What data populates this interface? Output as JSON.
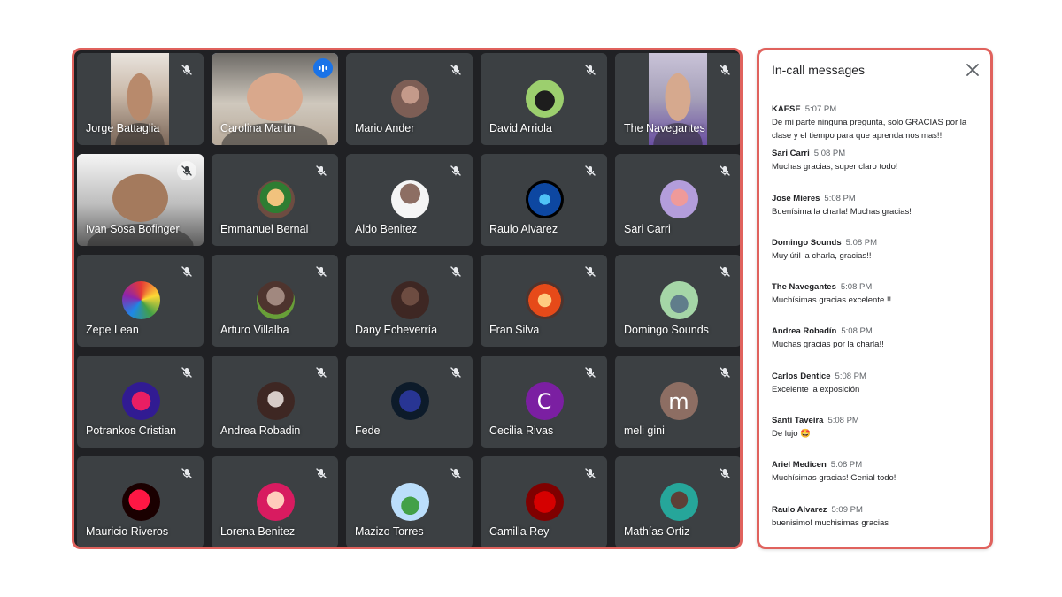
{
  "participants": [
    {
      "name": "Jorge Battaglia",
      "type": "video"
    },
    {
      "name": "Carolina Martin",
      "type": "video",
      "speaking": true
    },
    {
      "name": "Mario Ander",
      "type": "avatar"
    },
    {
      "name": "David Arriola",
      "type": "avatar"
    },
    {
      "name": "The Navegantes",
      "type": "video"
    },
    {
      "name": "Ivan Sosa Bofinger",
      "type": "video"
    },
    {
      "name": "Emmanuel Bernal",
      "type": "avatar"
    },
    {
      "name": "Aldo Benitez",
      "type": "avatar"
    },
    {
      "name": "Raulo Alvarez",
      "type": "avatar"
    },
    {
      "name": "Sari Carri",
      "type": "avatar"
    },
    {
      "name": "Zepe Lean",
      "type": "avatar"
    },
    {
      "name": "Arturo Villalba",
      "type": "avatar"
    },
    {
      "name": "Dany Echeverría",
      "type": "avatar"
    },
    {
      "name": "Fran Silva",
      "type": "avatar"
    },
    {
      "name": "Domingo Sounds",
      "type": "avatar"
    },
    {
      "name": "Potrankos Cristian",
      "type": "avatar"
    },
    {
      "name": "Andrea Robadin",
      "type": "avatar"
    },
    {
      "name": "Fede",
      "type": "avatar"
    },
    {
      "name": "Cecilia Rivas",
      "type": "letter",
      "letter": "C",
      "color": "#7b1fa2"
    },
    {
      "name": "meli gini",
      "type": "letter",
      "letter": "m",
      "color": "#8d6e63"
    },
    {
      "name": "Mauricio Riveros",
      "type": "avatar"
    },
    {
      "name": "Lorena Benitez",
      "type": "avatar"
    },
    {
      "name": "Mazizo Torres",
      "type": "avatar"
    },
    {
      "name": "Camilla Rey",
      "type": "avatar"
    },
    {
      "name": "Mathías Ortiz",
      "type": "avatar"
    }
  ],
  "chat": {
    "title": "In-call messages",
    "messages": [
      {
        "sender": "KAESE",
        "time": "5:07 PM",
        "text": "De mi parte ninguna pregunta, solo GRACIAS por la clase y el tiempo para que aprendamos mas!!"
      },
      {
        "sender": "Sari Carri",
        "time": "5:08 PM",
        "text": "Muchas gracias, super claro todo!"
      },
      {
        "sender": "Jose Mieres",
        "time": "5:08 PM",
        "text": "Buenísima la charla! Muchas gracias!"
      },
      {
        "sender": "Domingo Sounds",
        "time": "5:08 PM",
        "text": "Muy útil la charla, gracias!!"
      },
      {
        "sender": "The Navegantes",
        "time": "5:08 PM",
        "text": "Muchísimas gracias excelente !!"
      },
      {
        "sender": "Andrea Robadín",
        "time": "5:08 PM",
        "text": "Muchas gracias por la charla!!"
      },
      {
        "sender": "Carlos Dentice",
        "time": "5:08 PM",
        "text": "Excelente la exposición"
      },
      {
        "sender": "Santi Taveira",
        "time": "5:08 PM",
        "text": "De lujo 🤩"
      },
      {
        "sender": "Ariel Medicen",
        "time": "5:08 PM",
        "text": "Muchísimas gracias! Genial todo!"
      },
      {
        "sender": "Raulo Alvarez",
        "time": "5:09 PM",
        "text": "buenisimo! muchisimas gracias"
      }
    ]
  },
  "colors": {
    "highlight_border": "#e0625d",
    "tile_bg": "#3c4043",
    "grid_bg": "#202124",
    "speaking_outline": "#8ab4f8"
  }
}
